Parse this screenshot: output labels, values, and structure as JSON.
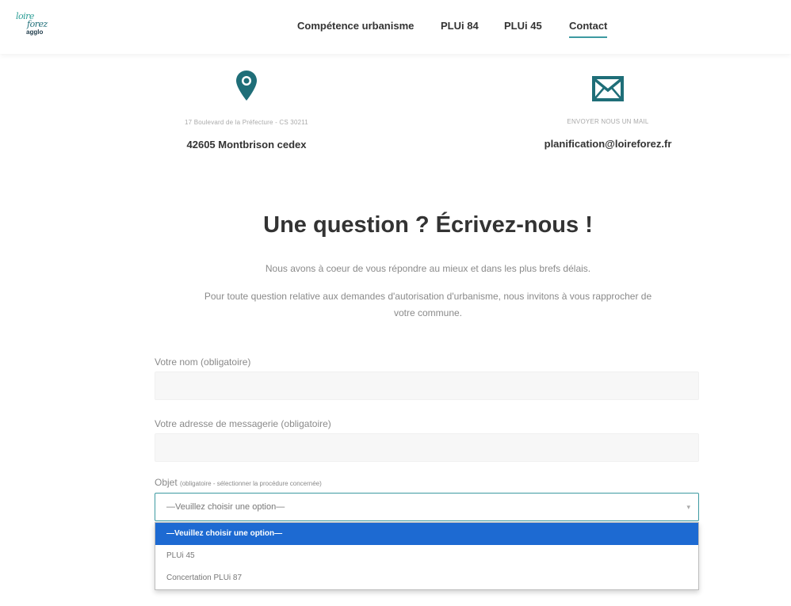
{
  "brand": {
    "line1": "loire",
    "line2": "forez",
    "line3": "agglo"
  },
  "nav": [
    {
      "label": "Compétence urbanisme"
    },
    {
      "label": "PLUi 84"
    },
    {
      "label": "PLUi 45"
    },
    {
      "label": "Contact",
      "active": true
    }
  ],
  "contact": {
    "address": {
      "icon": "map-marker-icon",
      "line_small": "17 Boulevard de la Préfecture - CS 30211",
      "line_main": "42605 Montbrison cedex"
    },
    "email": {
      "icon": "envelope-icon",
      "line_small": "ENVOYER NOUS UN MAIL",
      "line_main": "planification@loireforez.fr"
    }
  },
  "heading": "Une question ? Écrivez-nous !",
  "intro": {
    "line1": "Nous avons à coeur de vous répondre au mieux et dans les plus brefs délais.",
    "line2": "Pour toute question relative aux demandes d'autorisation d'urbanisme, nous invitons à vous rapprocher de",
    "line3": "votre commune."
  },
  "form": {
    "name_label": "Votre nom (obligatoire)",
    "name_value": "",
    "email_label": "Votre adresse de messagerie (obligatoire)",
    "email_value": "",
    "object_label": "Objet",
    "object_label_sub": "(obligatoire - sélectionner la procédure concernée)",
    "object_selected": "—Veuillez choisir une option—",
    "object_options": [
      "—Veuillez choisir une option—",
      "PLUi 45",
      "Concertation PLUi 87"
    ]
  },
  "colors": {
    "accent": "#3d9aa1",
    "icon": "#1f6e78",
    "highlight": "#1d6ad2"
  }
}
